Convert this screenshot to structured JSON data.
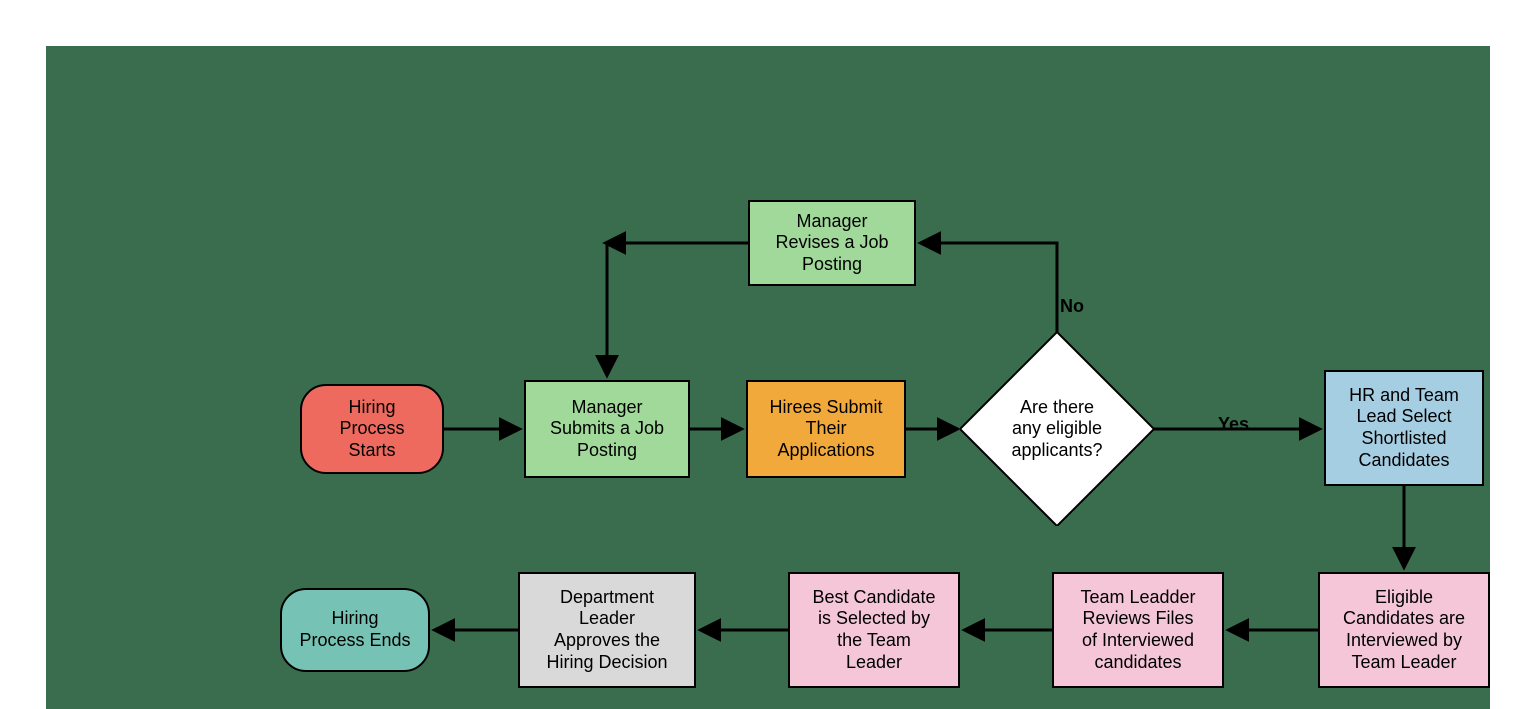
{
  "nodes": {
    "start": {
      "text": "Hiring\nProcess\nStarts"
    },
    "submit": {
      "text": "Manager\nSubmits a Job\nPosting"
    },
    "revise": {
      "text": "Manager\nRevises a Job\nPosting"
    },
    "hirees": {
      "text": "Hirees Submit\nTheir\nApplications"
    },
    "decision": {
      "text": "Are there\nany eligible\napplicants?"
    },
    "shortlist": {
      "text": "HR and Team\nLead Select\nShortlisted\nCandidates"
    },
    "interview": {
      "text": "Eligible\nCandidates are\nInterviewed by\nTeam Leader"
    },
    "review": {
      "text": "Team Leadder\nReviews  Files\nof Interviewed\ncandidates"
    },
    "select": {
      "text": "Best Candidate\nis Selected by\nthe Team\nLeader"
    },
    "approve": {
      "text": "Department\nLeader\nApproves the\nHiring Decision"
    },
    "end": {
      "text": "Hiring\nProcess Ends"
    }
  },
  "edges": {
    "no": "No",
    "yes": "Yes"
  },
  "colors": {
    "start": "#ee6a5e",
    "green": "#a1d99b",
    "orange": "#f2a93b",
    "white": "#ffffff",
    "blue": "#a6cee3",
    "pink": "#f4c6d7",
    "grey": "#d9d9d9",
    "end": "#76c2b4",
    "bg": "#3a6d4d"
  }
}
